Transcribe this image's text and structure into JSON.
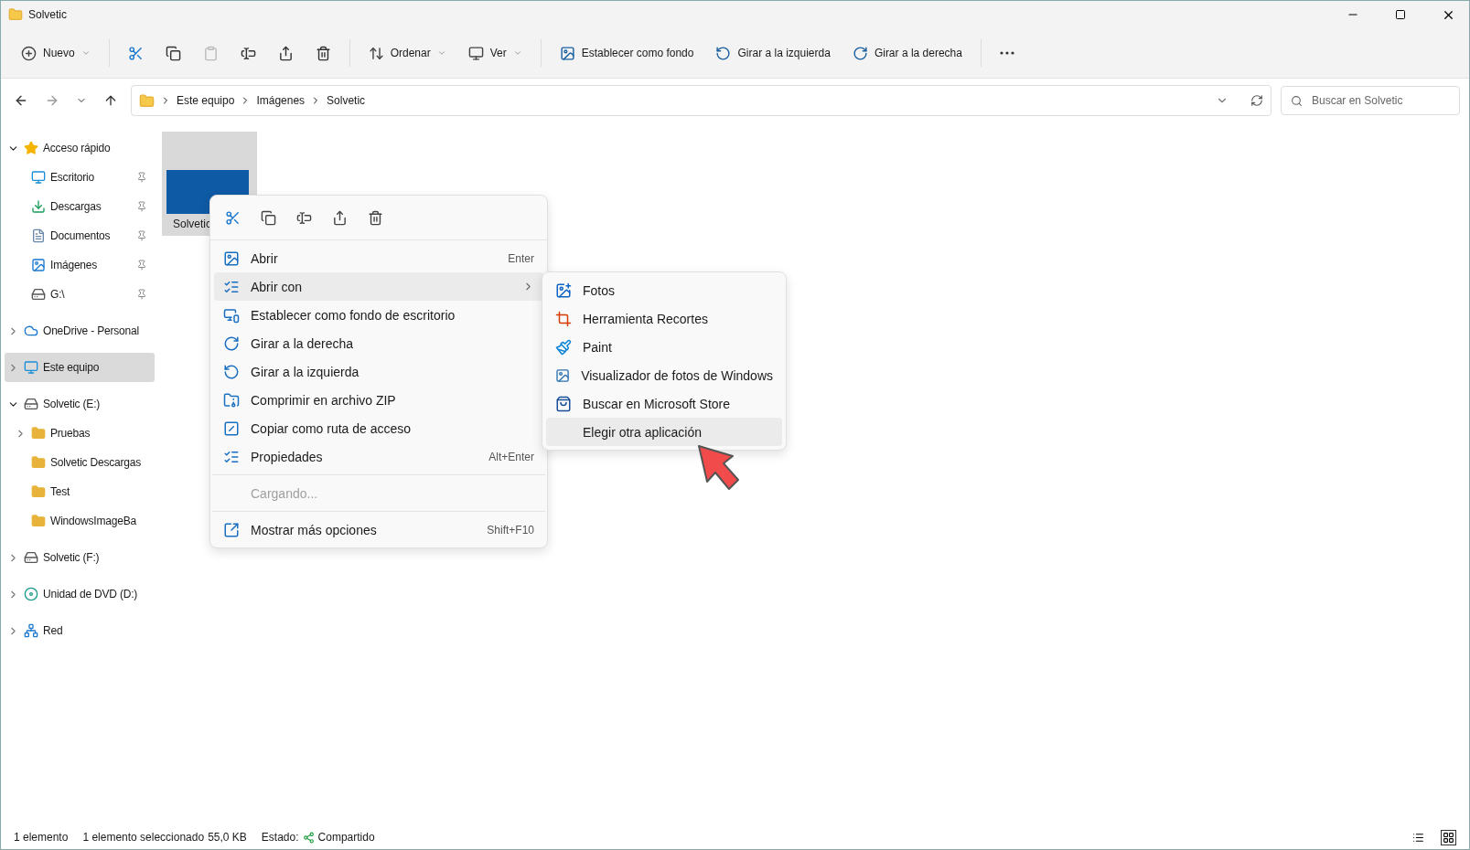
{
  "window": {
    "title": "Solvetic"
  },
  "toolbar": [
    {
      "kind": "menu",
      "label": "Nuevo",
      "disabled": false
    },
    {
      "kind": "separator"
    },
    {
      "kind": "icon",
      "disabled": false
    },
    {
      "kind": "icon",
      "disabled": false
    },
    {
      "kind": "icon",
      "disabled": true
    },
    {
      "kind": "icon",
      "disabled": false
    },
    {
      "kind": "icon",
      "disabled": false
    },
    {
      "kind": "icon",
      "disabled": false
    },
    {
      "kind": "separator"
    },
    {
      "kind": "menu",
      "label": "Ordenar",
      "disabled": false
    },
    {
      "kind": "menu",
      "label": "Ver",
      "disabled": false
    },
    {
      "kind": "separator"
    },
    {
      "kind": "button",
      "label": "Establecer como fondo",
      "disabled": false
    },
    {
      "kind": "button",
      "label": "Girar a la izquierda",
      "disabled": false
    },
    {
      "kind": "button",
      "label": "Girar a la derecha",
      "disabled": false
    },
    {
      "kind": "separator"
    },
    {
      "kind": "icon",
      "disabled": false
    }
  ],
  "address": {
    "path": [
      "Este equipo",
      "Imágenes",
      "Solvetic"
    ],
    "search_placeholder": "Buscar en Solvetic"
  },
  "sidebar": [
    {
      "label": "Acceso rápido",
      "kind": "star",
      "expanded": true,
      "selected": false,
      "children": [
        {
          "label": "Escritorio",
          "kind": "desktop",
          "pinned": true,
          "selected": false
        },
        {
          "label": "Descargas",
          "kind": "downloads",
          "pinned": true,
          "selected": false
        },
        {
          "label": "Documentos",
          "kind": "documents",
          "pinned": true,
          "selected": false
        },
        {
          "label": "Imágenes",
          "kind": "pictures",
          "pinned": true,
          "selected": false
        },
        {
          "label": "G:\\",
          "kind": "drive",
          "pinned": true,
          "selected": false
        }
      ]
    },
    {
      "label": "OneDrive - Personal",
      "kind": "cloud",
      "expanded": false,
      "selected": false
    },
    {
      "label": "Este equipo",
      "kind": "pc",
      "expanded": false,
      "selected": true
    },
    {
      "label": "Solvetic (E:)",
      "kind": "drive",
      "expanded": true,
      "selected": false,
      "children": [
        {
          "label": "Pruebas",
          "kind": "folder",
          "expanded": false,
          "selected": false
        },
        {
          "label": "Solvetic Descargas",
          "kind": "folder",
          "selected": false
        },
        {
          "label": "Test",
          "kind": "folder",
          "selected": false
        },
        {
          "label": "WindowsImageBa",
          "kind": "folder",
          "selected": false
        }
      ]
    },
    {
      "label": "Solvetic (F:)",
      "kind": "drive",
      "expanded": false,
      "selected": false
    },
    {
      "label": "Unidad de DVD (D:)",
      "kind": "dvd",
      "expanded": false,
      "selected": false
    },
    {
      "label": "Red",
      "kind": "network",
      "expanded": false,
      "selected": false
    }
  ],
  "files": [
    {
      "name": "Solvetic",
      "selected": true
    }
  ],
  "context_menu": {
    "items": [
      {
        "kind": "item",
        "label": "Abrir",
        "shortcut": "Enter",
        "selected": false
      },
      {
        "kind": "submenu",
        "label": "Abrir con",
        "selected": true
      },
      {
        "kind": "item",
        "label": "Establecer como fondo de escritorio",
        "selected": false
      },
      {
        "kind": "item",
        "label": "Girar a la derecha",
        "selected": false
      },
      {
        "kind": "item",
        "label": "Girar a la izquierda",
        "selected": false
      },
      {
        "kind": "item",
        "label": "Comprimir en archivo ZIP",
        "selected": false
      },
      {
        "kind": "item",
        "label": "Copiar como ruta de acceso",
        "selected": false
      },
      {
        "kind": "item",
        "label": "Propiedades",
        "shortcut": "Alt+Enter",
        "selected": false
      },
      {
        "kind": "separator"
      },
      {
        "kind": "loading",
        "label": "Cargando..."
      },
      {
        "kind": "separator"
      },
      {
        "kind": "item",
        "label": "Mostrar más opciones",
        "shortcut": "Shift+F10",
        "selected": false
      }
    ]
  },
  "submenu": [
    {
      "label": "Fotos",
      "kind": "photos",
      "selected": false
    },
    {
      "label": "Herramienta Recortes",
      "kind": "snip",
      "selected": false
    },
    {
      "label": "Paint",
      "kind": "paint",
      "selected": false
    },
    {
      "label": "Visualizador de fotos de Windows",
      "kind": "viewer",
      "selected": false
    },
    {
      "label": "Buscar en Microsoft Store",
      "kind": "store",
      "selected": false
    },
    {
      "label": "Elegir otra aplicación",
      "kind": "plain",
      "selected": true
    }
  ],
  "status_bar": {
    "count": "1 elemento",
    "selection": "1 elemento seleccionado",
    "size": "55,0 KB",
    "state_label": "Estado:",
    "state": "Compartido",
    "views": [
      {
        "selected": false
      },
      {
        "selected": true
      }
    ]
  }
}
